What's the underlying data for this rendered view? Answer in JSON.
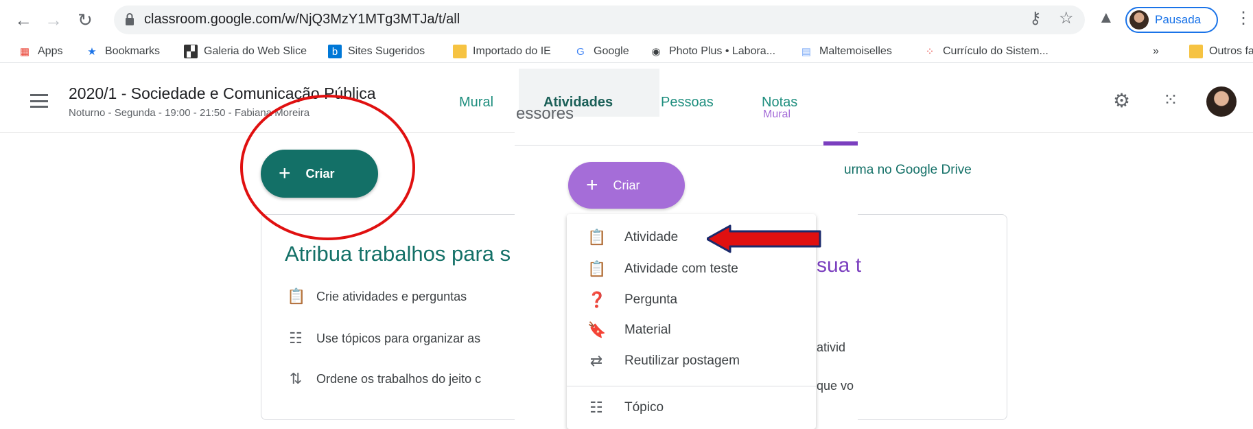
{
  "browser": {
    "url": "classroom.google.com/w/NjQ3MzY1MTg3MTJa/t/all",
    "profile_label": "Pausada",
    "bookmarks": [
      {
        "label": "Apps",
        "icon": "apps-grid-icon",
        "color": "#ea4335"
      },
      {
        "label": "Bookmarks",
        "icon": "star-icon",
        "color": "#1a73e8"
      },
      {
        "label": "Galeria do Web Slice",
        "icon": "web-slice-icon",
        "color": "#333333"
      },
      {
        "label": "Sites Sugeridos",
        "icon": "bing-icon",
        "color": "#0078d7"
      },
      {
        "label": "Importado do IE",
        "icon": "folder-icon",
        "color": "#f6c342"
      },
      {
        "label": "Google",
        "icon": "google-icon",
        "color": "#4285f4"
      },
      {
        "label": "Photo Plus • Labora...",
        "icon": "globe-icon",
        "color": "#3c4043"
      },
      {
        "label": "Maltemoiselles",
        "icon": "page-icon",
        "color": "#7baaf7"
      },
      {
        "label": "Currículo do Sistem...",
        "icon": "spinner-icon",
        "color": "#e53935"
      }
    ],
    "overflow": "»",
    "other_bookmarks": "Outros favoritos"
  },
  "classroom": {
    "class_title": "2020/1 - Sociedade e Comunicação Pública",
    "class_subtitle": "Noturno - Segunda - 19:00 - 21:50 - Fabiana Moreira",
    "tabs": [
      {
        "label": "Mural",
        "active": false
      },
      {
        "label": "Atividades",
        "active": true
      },
      {
        "label": "Pessoas",
        "active": false
      },
      {
        "label": "Notas",
        "active": false
      }
    ],
    "create_label": "Criar",
    "card": {
      "title": "Atribua trabalhos para s",
      "items": [
        {
          "icon": "assignment-icon",
          "text": "Crie atividades e perguntas"
        },
        {
          "icon": "topic-list-icon",
          "text": "Use tópicos para organizar as"
        },
        {
          "icon": "reorder-arrows-icon",
          "text": "Ordene os trabalhos do jeito c"
        }
      ]
    }
  },
  "overlay": {
    "header_fragment": "essores",
    "tab_fragment": "Mural",
    "create_label": "Criar",
    "drive_text": "urma no Google Drive",
    "right_card_fragments": [
      "sua t",
      "ativid",
      "que vo"
    ],
    "menu": [
      {
        "icon": "assignment-icon",
        "label": "Atividade"
      },
      {
        "icon": "quiz-assignment-icon",
        "label": "Atividade com teste"
      },
      {
        "icon": "question-icon",
        "label": "Pergunta"
      },
      {
        "icon": "material-bookmark-icon",
        "label": "Material"
      },
      {
        "icon": "reuse-post-icon",
        "label": "Reutilizar postagem"
      },
      {
        "icon": "topic-icon",
        "label": "Tópico"
      }
    ]
  },
  "colors": {
    "teal": "#137067",
    "purple": "#a56dd8",
    "annotation_red": "#e01010",
    "link_blue": "#1a73e8"
  }
}
